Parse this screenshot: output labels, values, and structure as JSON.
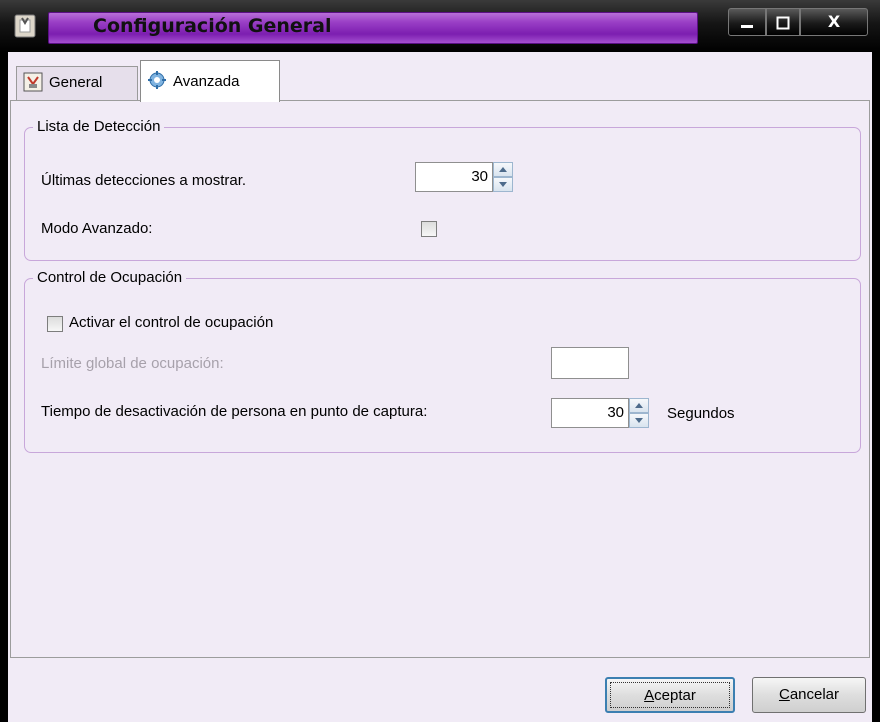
{
  "window": {
    "title": "Configuración General",
    "controls": {
      "minimize": "▁",
      "maximize": "▢",
      "close": "X"
    }
  },
  "tabs": [
    {
      "label": "General",
      "icon": "general-settings-icon",
      "selected": false
    },
    {
      "label": "Avanzada",
      "icon": "advanced-settings-icon",
      "selected": true
    }
  ],
  "detection_group": {
    "title": "Lista de Detección",
    "last_detections_label": "Últimas detecciones a mostrar.",
    "last_detections_value": "30",
    "advanced_mode_label": "Modo Avanzado:",
    "advanced_mode_checked": false
  },
  "occupancy_group": {
    "title": "Control de Ocupación",
    "activate_label": "Activar el control de ocupación",
    "activate_checked": false,
    "global_limit_label": "Límite global de ocupación:",
    "global_limit_value": "",
    "deactivation_time_label": "Tiempo de desactivación de persona en punto de captura:",
    "deactivation_time_value": "30",
    "deactivation_time_unit": "Segundos"
  },
  "buttons": {
    "accept_first": "A",
    "accept_rest": "ceptar",
    "cancel_first": "C",
    "cancel_rest": "ancelar"
  },
  "colors": {
    "title_band": "#8a2fbe",
    "client_bg": "#f1ebf6",
    "group_border": "#c8a7da"
  }
}
